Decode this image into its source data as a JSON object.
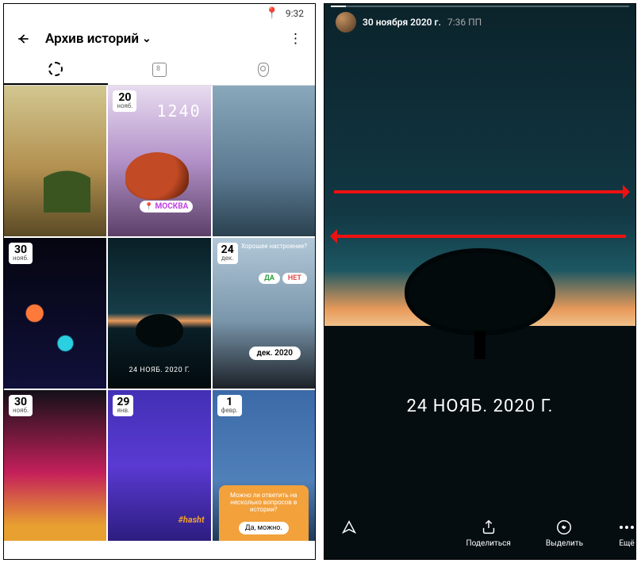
{
  "status": {
    "time": "9:32"
  },
  "header": {
    "title": "Архив историй"
  },
  "tabs": {
    "calendar_day": "8"
  },
  "grid": {
    "items": [
      {
        "day": "",
        "month": "",
        "extra": ""
      },
      {
        "day": "20",
        "month": "нояб.",
        "clock": "1240",
        "moscow": "МОСКВА"
      },
      {
        "day": "",
        "month": ""
      },
      {
        "day": "30",
        "month": "нояб."
      },
      {
        "day": "",
        "month": "",
        "caption": "24 НОЯБ. 2020 Г."
      },
      {
        "day": "24",
        "month": "дек.",
        "poll_q": "Хорошее настроение?",
        "yes": "ДА",
        "no": "НЕТ",
        "month_pill": "дек. 2020"
      },
      {
        "day": "30",
        "month": "нояб."
      },
      {
        "day": "29",
        "month": "янв.",
        "hashtag": "#hasht"
      },
      {
        "day": "1",
        "month": "февр.",
        "card_q": "Можно ли ответить на несколько вопросов в истории?",
        "card_a": "Да, можно."
      }
    ]
  },
  "story": {
    "date_label": "30 ноября 2020 г.",
    "time_label": "7:36 ПП",
    "big_date": "24 НОЯБ. 2020 Г.",
    "share": "Поделиться",
    "highlight": "Выделить",
    "more": "Ещё"
  }
}
